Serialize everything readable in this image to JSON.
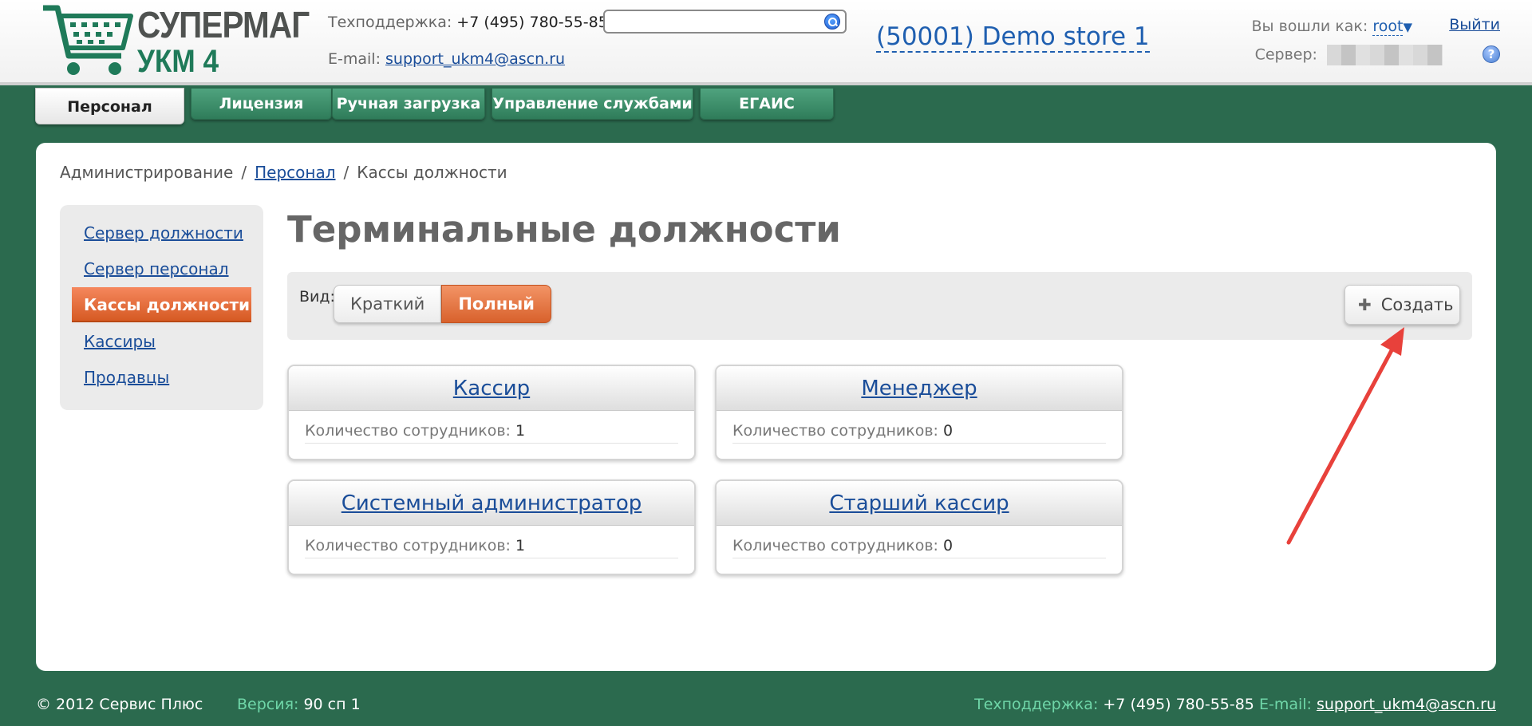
{
  "brand": {
    "line1": "СУПЕРМАГ",
    "line2": "УКМ 4"
  },
  "header": {
    "support_label": "Техподдержка:",
    "support_phone": "+7 (495) 780-55-85",
    "email_label": "E-mail:",
    "email": "support_ukm4@ascn.ru",
    "search_value": "",
    "store": "(50001) Demo store 1",
    "logged_as_label": "Вы вошли как:",
    "user": "root",
    "logout": "Выйти",
    "server_label": "Сервер:",
    "help": "?"
  },
  "tabs": [
    {
      "label": "Персонал",
      "active": true
    },
    {
      "label": "Лицензия"
    },
    {
      "label": "Ручная загрузка"
    },
    {
      "label": "Управление службами"
    },
    {
      "label": "ЕГАИС"
    }
  ],
  "breadcrumb": {
    "root": "Администрирование",
    "sep": "/",
    "link": "Персонал",
    "current": "Кассы должности"
  },
  "sidebar": {
    "items": [
      {
        "label": "Сервер должности"
      },
      {
        "label": "Сервер персонал"
      },
      {
        "label": "Кассы должности",
        "active": true
      },
      {
        "label": "Кассиры"
      },
      {
        "label": "Продавцы"
      }
    ]
  },
  "page": {
    "title": "Терминальные должности"
  },
  "toolbar": {
    "view_label": "Вид:",
    "short": "Краткий",
    "full": "Полный",
    "create": "Создать"
  },
  "cards": [
    {
      "title": "Кассир",
      "count_label": "Количество сотрудников:",
      "count": "1"
    },
    {
      "title": "Менеджер",
      "count_label": "Количество сотрудников:",
      "count": "0"
    },
    {
      "title": "Системный администратор",
      "count_label": "Количество сотрудников:",
      "count": "1"
    },
    {
      "title": "Старший кассир",
      "count_label": "Количество сотрудников:",
      "count": "0"
    }
  ],
  "footer": {
    "copyright": "© 2012 Сервис Плюс",
    "version_label": "Версия:",
    "version": "90 сп 1",
    "support_label": "Техподдержка:",
    "support_phone": "+7 (495) 780-55-85",
    "email_label": "E-mail:",
    "email": "support_ukm4@ascn.ru"
  },
  "colors": {
    "background": "#2b6a4e",
    "tab_green": "#3b8d69",
    "active_orange": "#e06a35",
    "link_blue": "#1a4d99",
    "arrow_red": "#e8413b"
  }
}
